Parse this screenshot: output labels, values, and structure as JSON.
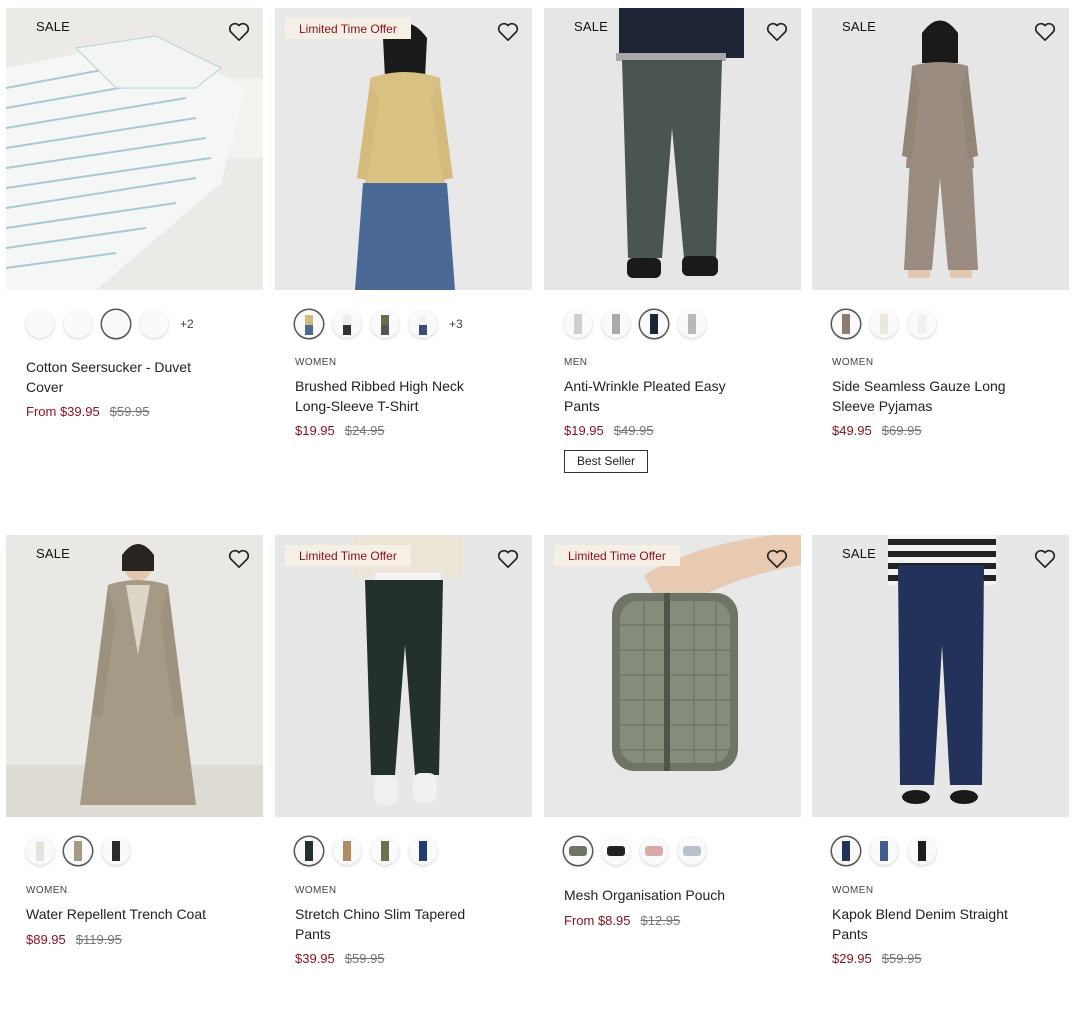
{
  "colors": {
    "accent": "#8b0f1e",
    "offer_bg": "#f6efe6"
  },
  "products": [
    {
      "sale_label": "SALE",
      "offer_label": "",
      "category": "",
      "name": "Cotton Seersucker - Duvet Cover",
      "price": "From $39.95",
      "was": "$59.95",
      "more": "+2",
      "badge": ""
    },
    {
      "sale_label": "",
      "offer_label": "Limited Time Offer",
      "category": "WOMEN",
      "name": "Brushed Ribbed High Neck Long-Sleeve T-Shirt",
      "price": "$19.95",
      "was": "$24.95",
      "more": "+3",
      "badge": ""
    },
    {
      "sale_label": "SALE",
      "offer_label": "",
      "category": "MEN",
      "name": "Anti-Wrinkle Pleated Easy Pants",
      "price": "$19.95",
      "was": "$49.95",
      "more": "",
      "badge": "Best Seller"
    },
    {
      "sale_label": "SALE",
      "offer_label": "",
      "category": "WOMEN",
      "name": "Side Seamless Gauze Long Sleeve Pyjamas",
      "price": "$49.95",
      "was": "$69.95",
      "more": "",
      "badge": ""
    },
    {
      "sale_label": "SALE",
      "offer_label": "",
      "category": "WOMEN",
      "name": "Water Repellent Trench Coat",
      "price": "$89.95",
      "was": "$119.95",
      "more": "",
      "badge": ""
    },
    {
      "sale_label": "",
      "offer_label": "Limited Time Offer",
      "category": "WOMEN",
      "name": "Stretch Chino Slim Tapered Pants",
      "price": "$39.95",
      "was": "$59.95",
      "more": "",
      "badge": ""
    },
    {
      "sale_label": "",
      "offer_label": "Limited Time Offer",
      "category": "",
      "name": "Mesh Organisation Pouch",
      "price": "From $8.95",
      "was": "$12.95",
      "more": "",
      "badge": ""
    },
    {
      "sale_label": "SALE",
      "offer_label": "",
      "category": "WOMEN",
      "name": "Kapok Blend Denim Straight Pants",
      "price": "$29.95",
      "was": "$59.95",
      "more": "",
      "badge": ""
    }
  ],
  "icons": {
    "wishlist": "heart-icon"
  }
}
